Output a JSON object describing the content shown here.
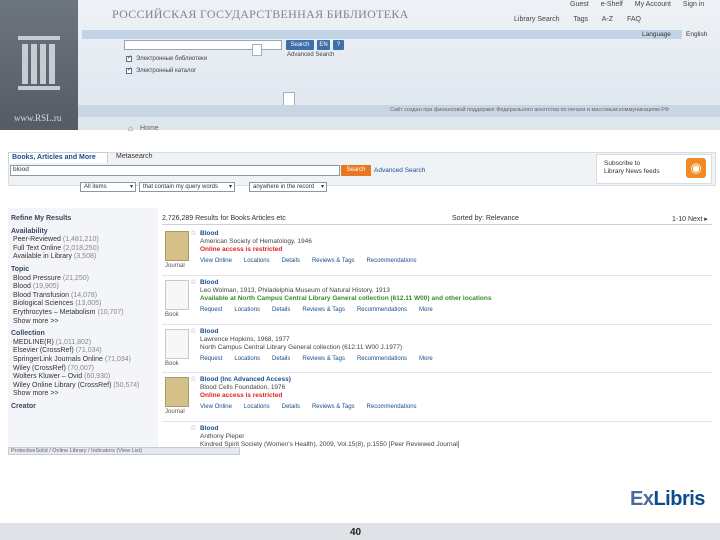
{
  "header": {
    "site_title": "РОССИЙСКАЯ ГОСУДАРСТВЕННАЯ БИБЛИОТЕКА",
    "user_links": [
      "Guest",
      "e-Shelf",
      "My Account",
      "Sign in"
    ],
    "top_links": [
      "Library Search",
      "Tags",
      "A-Z",
      "FAQ"
    ],
    "language_label": "Language",
    "language_value": "English",
    "catalog_search_buttons": [
      "Search",
      "EN",
      "?"
    ],
    "catalog_advanced": "Advanced Search",
    "checkbox_labels": [
      "Электронные библиотеки",
      "Электронный каталог"
    ],
    "footer_text": "Сайт создан при финансовой поддержке Федерального агентства по печати и массовым коммуникациям РФ",
    "logo_text": "www.RSL.ru"
  },
  "breadcrumb": {
    "icon": "house-icon",
    "text": "Home"
  },
  "search": {
    "tab_active": "Books, Articles and More",
    "tab_other": "Metasearch",
    "query": "blood",
    "button": "Search",
    "advanced": "Advanced Search",
    "filters": [
      "All items",
      "that contain my query words",
      "anywhere in the record"
    ]
  },
  "subscribe": {
    "line1": "Subscribe to",
    "line2": "Library News feeds"
  },
  "facets": [
    {
      "kind": "heading",
      "text": "Refine My Results"
    },
    {
      "kind": "heading",
      "text": "Availability"
    },
    {
      "kind": "item",
      "text": "Peer-Reviewed",
      "count": "(1,481,210)"
    },
    {
      "kind": "item",
      "text": "Full Text Online",
      "count": "(2,018,250)"
    },
    {
      "kind": "item",
      "text": "Available in Library",
      "count": "(3,508)"
    },
    {
      "kind": "heading",
      "text": "Topic"
    },
    {
      "kind": "item",
      "text": "Blood Pressure",
      "count": "(21,250)"
    },
    {
      "kind": "item",
      "text": "Blood",
      "count": "(19,905)"
    },
    {
      "kind": "item",
      "text": "Blood Transfusion",
      "count": "(14,078)"
    },
    {
      "kind": "item",
      "text": "Biological Sciences",
      "count": "(13,005)"
    },
    {
      "kind": "item",
      "text": "Erythrocytes – Metabolism",
      "count": "(10,707)"
    },
    {
      "kind": "item",
      "text": "Show more >>",
      "count": ""
    },
    {
      "kind": "heading",
      "text": "Collection"
    },
    {
      "kind": "item",
      "text": "MEDLINE(R)",
      "count": "(1,011,802)"
    },
    {
      "kind": "item",
      "text": "Elsevier (CrossRef)",
      "count": "(71,034)"
    },
    {
      "kind": "item",
      "text": "SpringerLink Journals Online",
      "count": "(71,034)"
    },
    {
      "kind": "item",
      "text": "Wiley (CrossRef)",
      "count": "(70,007)"
    },
    {
      "kind": "item",
      "text": "Wolters Kluwer – Ovid",
      "count": "(60,930)"
    },
    {
      "kind": "item",
      "text": "Wiley Online Library (CrossRef)",
      "count": "(50,574)"
    },
    {
      "kind": "item",
      "text": "Show more >>",
      "count": ""
    },
    {
      "kind": "heading",
      "text": "Creator"
    }
  ],
  "facet_dropdown": "ProtectiveSolid / Online Library / Indicators (View List)",
  "results": {
    "count_text": "2,726,289 Results for Books Articles etc",
    "sorted_label": "Sorted by: Relevance",
    "pager": "1-10 Next ▸",
    "items": [
      {
        "type": "Journal",
        "title": "Blood",
        "line1": "American Society of Hematology, 1946",
        "status": "Online access is restricted",
        "status_kind": "red",
        "tabs": [
          "View Online",
          "Locations",
          "Details",
          "Reviews & Tags",
          "Recommendations"
        ]
      },
      {
        "type": "Book",
        "title": "Blood",
        "line1": "Leo Wolman, 1913, Philadelphia Museum of Natural History, 1913",
        "status": "Available at North Campus Central Library General collection (612.11 W00)",
        "status_extra": "and other locations",
        "status_kind": "green",
        "tabs": [
          "Request",
          "Locations",
          "Details",
          "Reviews & Tags",
          "Recommendations",
          "More"
        ]
      },
      {
        "type": "Book",
        "title": "Blood",
        "line1": "Lawrence Hopkins, 1968, 1977",
        "status": "North Campus Central Library General collection (612.11 W00 J.1977)",
        "status_kind": "plain",
        "tabs": [
          "Request",
          "Locations",
          "Details",
          "Reviews & Tags",
          "Recommendations",
          "More"
        ]
      },
      {
        "type": "Journal",
        "title": "Blood (Inc Advanced Access)",
        "line1": "Blood Cells Foundation, 1976",
        "status": "Online access is restricted",
        "status_kind": "red",
        "tabs": [
          "View Online",
          "Locations",
          "Details",
          "Reviews & Tags",
          "Recommendations"
        ]
      },
      {
        "type": "",
        "title": "Blood",
        "line1": "Anthony Pieper",
        "line2": "Kindred Spirit Society (Women's Health), 2009, Vol.15(8), p.1550 [Peer Reviewed Journal]",
        "status": "",
        "status_kind": "plain",
        "tabs": []
      }
    ]
  },
  "brand": {
    "ex": "Ex",
    "libris": "Libris"
  },
  "page_number": "40"
}
